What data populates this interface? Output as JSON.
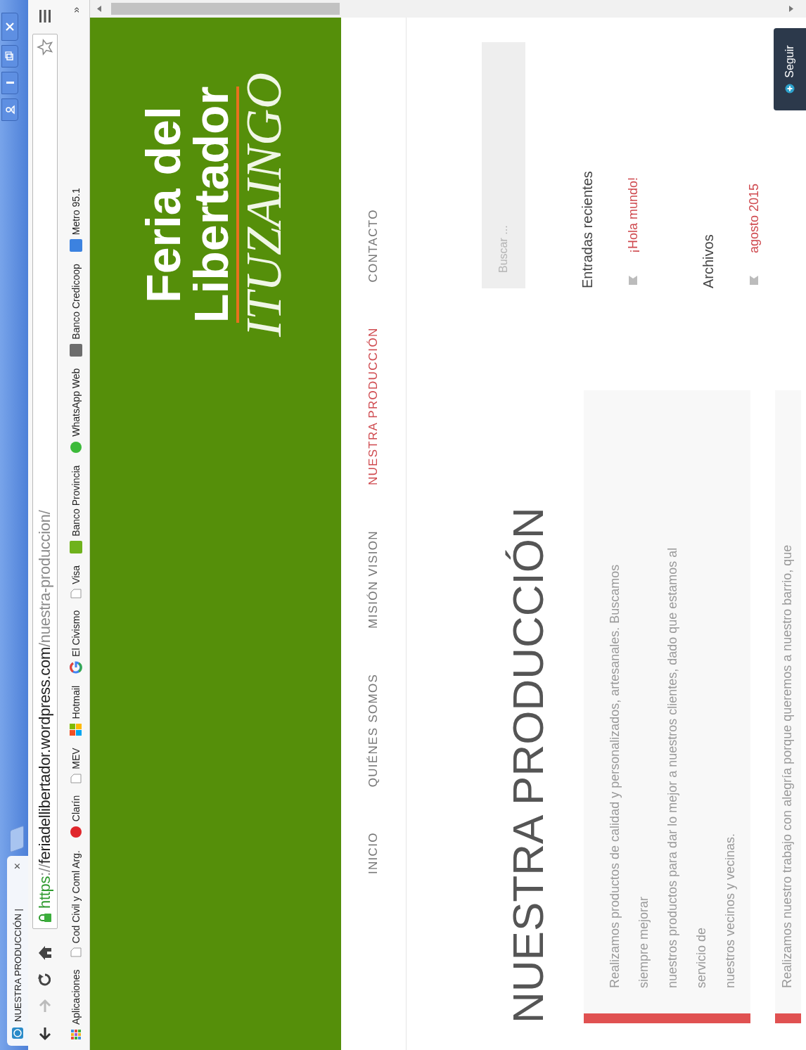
{
  "browser": {
    "tab": {
      "title": "NUESTRA PRODUCCIÓN |",
      "close": "×"
    },
    "address": {
      "scheme": "https",
      "separator": "://",
      "host": "feriadellibertador.wordpress.com",
      "path": "/nuestra-produccion/"
    },
    "bookmarks": [
      {
        "label": "Aplicaciones",
        "kind": "grid"
      },
      {
        "label": "Cod Civil y Coml Arg.",
        "kind": "page"
      },
      {
        "label": "Clarín",
        "kind": "disc",
        "color": "#e0262b"
      },
      {
        "label": "MEV",
        "kind": "page"
      },
      {
        "label": "Hotmail",
        "kind": "tiles"
      },
      {
        "label": "El Civismo",
        "kind": "ring"
      },
      {
        "label": "Visa",
        "kind": "page"
      },
      {
        "label": "Banco Provincia",
        "kind": "square",
        "color": "#6fb21c"
      },
      {
        "label": "WhatsApp Web",
        "kind": "disc",
        "color": "#3cba3a"
      },
      {
        "label": "Banco Credicoop",
        "kind": "square",
        "color": "#6d6d6d"
      },
      {
        "label": "Metro 95.1",
        "kind": "square",
        "color": "#3c82e0"
      }
    ],
    "overflow": "»"
  },
  "site": {
    "title_lines": [
      "Feria del",
      "Libertador"
    ],
    "subtitle": "ITUZAINGO"
  },
  "nav": [
    {
      "label": "INICIO",
      "selected": false
    },
    {
      "label": "QUIÉNES SOMOS",
      "selected": false
    },
    {
      "label": "MISIÓN VISION",
      "selected": false
    },
    {
      "label": "NUESTRA PRODUCCIÓN",
      "selected": true
    },
    {
      "label": "CONTACTO",
      "selected": false
    }
  ],
  "page_title": "NUESTRA PRODUCCIÓN",
  "articles": [
    {
      "text": "Realizamos productos de calidad y personalizados, artesanales. Buscamos\nsiempre mejorar\nnuestros productos para dar lo mejor a nuestros clientes, dado que estamos al\nservicio de\nnuestros vecinos y vecinas."
    },
    {
      "text": "Realizamos nuestro trabajo con alegría porque queremos a nuestro barrio, que"
    }
  ],
  "sidebar": {
    "search": {
      "placeholder": "Buscar ..."
    },
    "widgets": [
      {
        "title": "Entradas recientes",
        "links": [
          "¡Hola mundo!"
        ]
      },
      {
        "title": "Archivos",
        "links": [
          "agosto 2015"
        ]
      }
    ]
  },
  "follow_button": {
    "label": "Seguir"
  }
}
